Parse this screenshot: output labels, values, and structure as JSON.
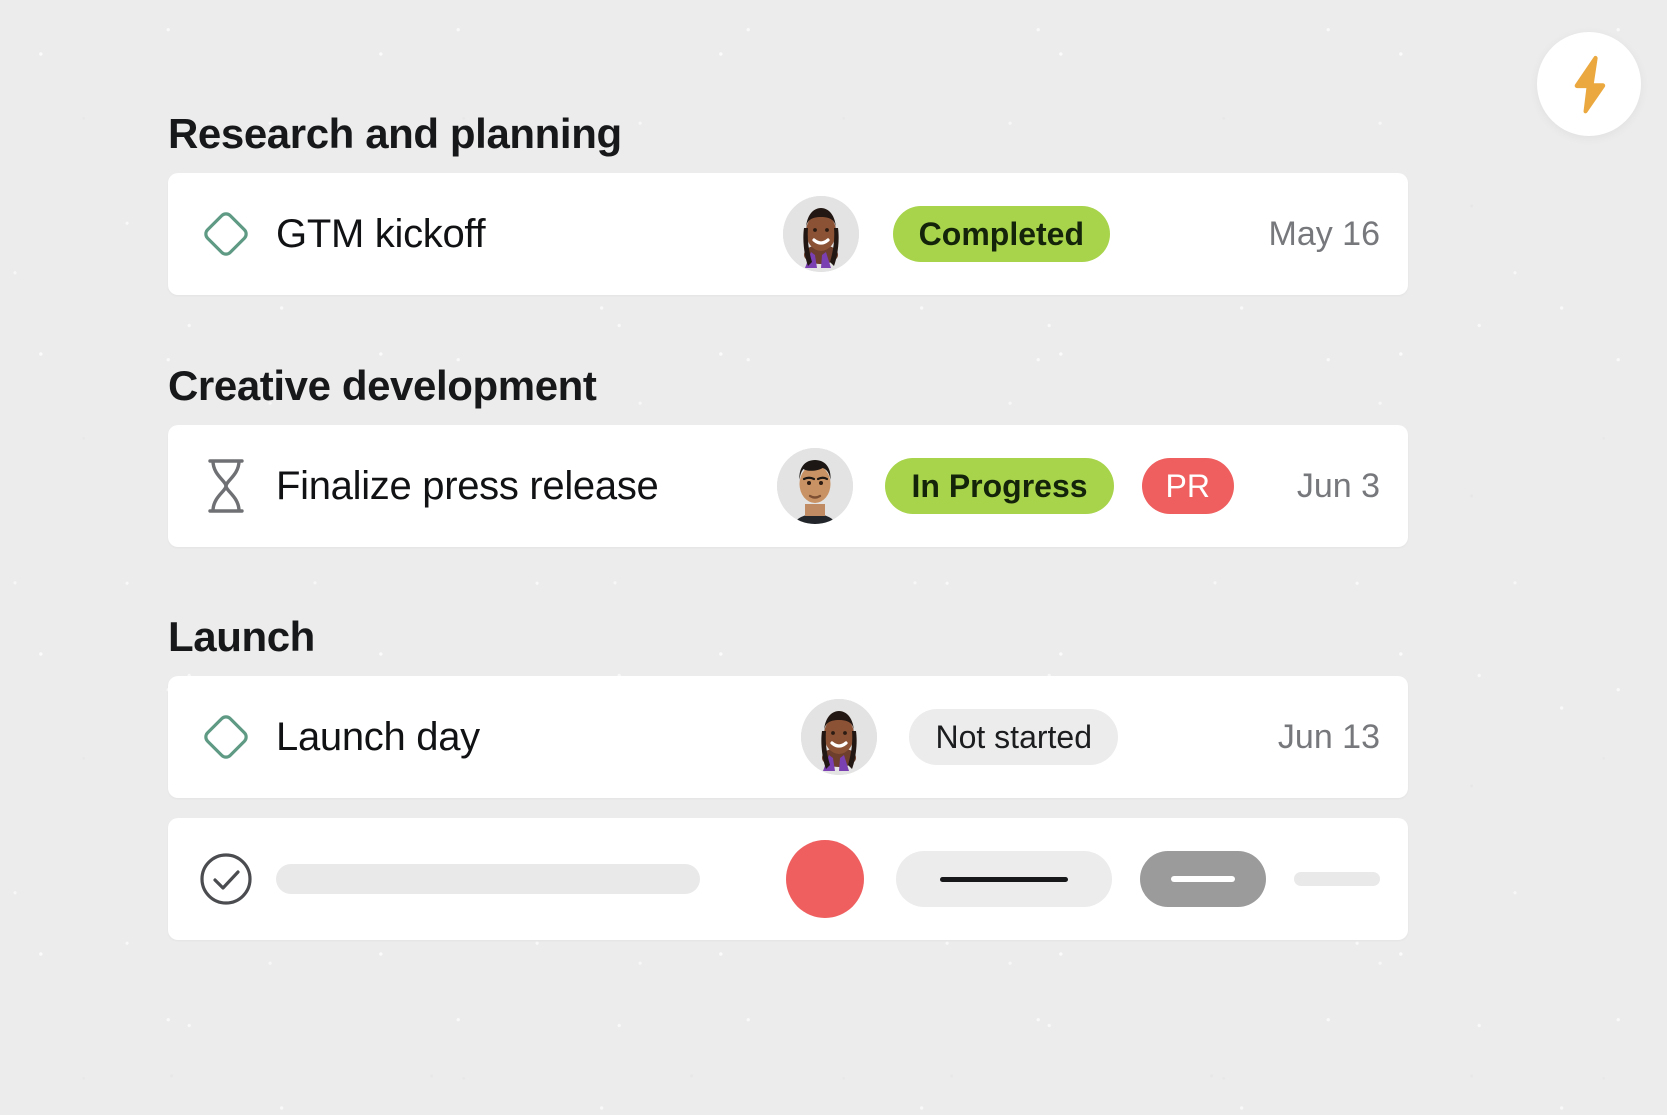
{
  "app": {
    "bolt_icon": "lightning-bolt-icon",
    "bolt_color": "#eaa83f",
    "background_color": "#ececec"
  },
  "colors": {
    "card": "#ffffff",
    "status_green": "#a8d44c",
    "status_grey": "#ececec",
    "tag_red": "#ef5f5f",
    "diamond_green": "#5e9a84",
    "hourglass_grey": "#6e7073",
    "date_text": "#76787c",
    "skeleton_grey": "#e9e9e9",
    "skeleton_dark": "#9b9b9b"
  },
  "sections": [
    {
      "title": "Research and planning",
      "task": {
        "icon": "diamond-outline-icon",
        "name": "GTM kickoff",
        "assignee_avatar": "avatar-woman-dark-hair",
        "status": "Completed",
        "status_style": "green",
        "tag": null,
        "date": "May 16"
      }
    },
    {
      "title": "Creative development",
      "task": {
        "icon": "hourglass-icon",
        "name": "Finalize press release",
        "assignee_avatar": "avatar-man-dark-hair",
        "status": "In Progress",
        "status_style": "green",
        "tag": "PR",
        "date": "Jun 3"
      }
    },
    {
      "title": "Launch",
      "task": {
        "icon": "diamond-outline-icon",
        "name": "Launch day",
        "assignee_avatar": "avatar-woman-dark-hair",
        "status": "Not started",
        "status_style": "grey",
        "tag": null,
        "date": "Jun 13"
      }
    }
  ],
  "skeleton_row": {
    "icon": "check-circle-icon",
    "placeholder_bar": "",
    "circle_color": "#ef5f5f",
    "pill_light": "",
    "pill_dark": "",
    "tail_bar": ""
  }
}
